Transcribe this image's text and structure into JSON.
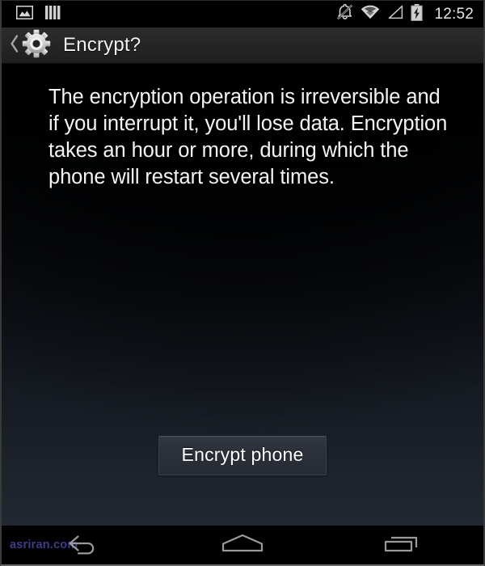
{
  "statusbar": {
    "left_icons": [
      {
        "name": "screenshot-image-icon",
        "label": "Screenshot captured"
      },
      {
        "name": "sim-card-bars-icon",
        "label": "SIM card"
      }
    ],
    "right_icons": [
      {
        "name": "ringer-muted-icon",
        "label": "Ringer silenced"
      },
      {
        "name": "wifi-icon",
        "label": "Wi-Fi connected"
      },
      {
        "name": "cell-signal-icon",
        "label": "No cellular signal"
      },
      {
        "name": "battery-charging-icon",
        "label": "Battery charging"
      }
    ],
    "clock": "12:52"
  },
  "actionbar": {
    "up_icon": "back-chevron-icon",
    "app_icon": "settings-gear-icon",
    "title": "Encrypt?"
  },
  "content": {
    "warning_text": "The encryption operation is irreversible and if you interrupt it, you'll lose data. Encryption takes an hour or more, during which the phone will restart several times.",
    "primary_button_label": "Encrypt phone"
  },
  "navbar": {
    "watermark": "asriran.com",
    "keys": [
      {
        "name": "nav-back-button",
        "icon": "back-arrow-icon",
        "label": "Back"
      },
      {
        "name": "nav-home-button",
        "icon": "home-icon",
        "label": "Home"
      },
      {
        "name": "nav-recents-button",
        "icon": "recent-apps-icon",
        "label": "Recent apps"
      }
    ]
  },
  "colors": {
    "status_bar_bg": "#000000",
    "action_bar_bg": "#2a2a2a",
    "content_bg_top": "#000000",
    "content_bg_bottom": "#222831",
    "button_bg": "#2b3039",
    "text_primary": "#f4f4f4",
    "watermark": "#3c3c8f",
    "nav_icon": "#9a9a9a"
  }
}
